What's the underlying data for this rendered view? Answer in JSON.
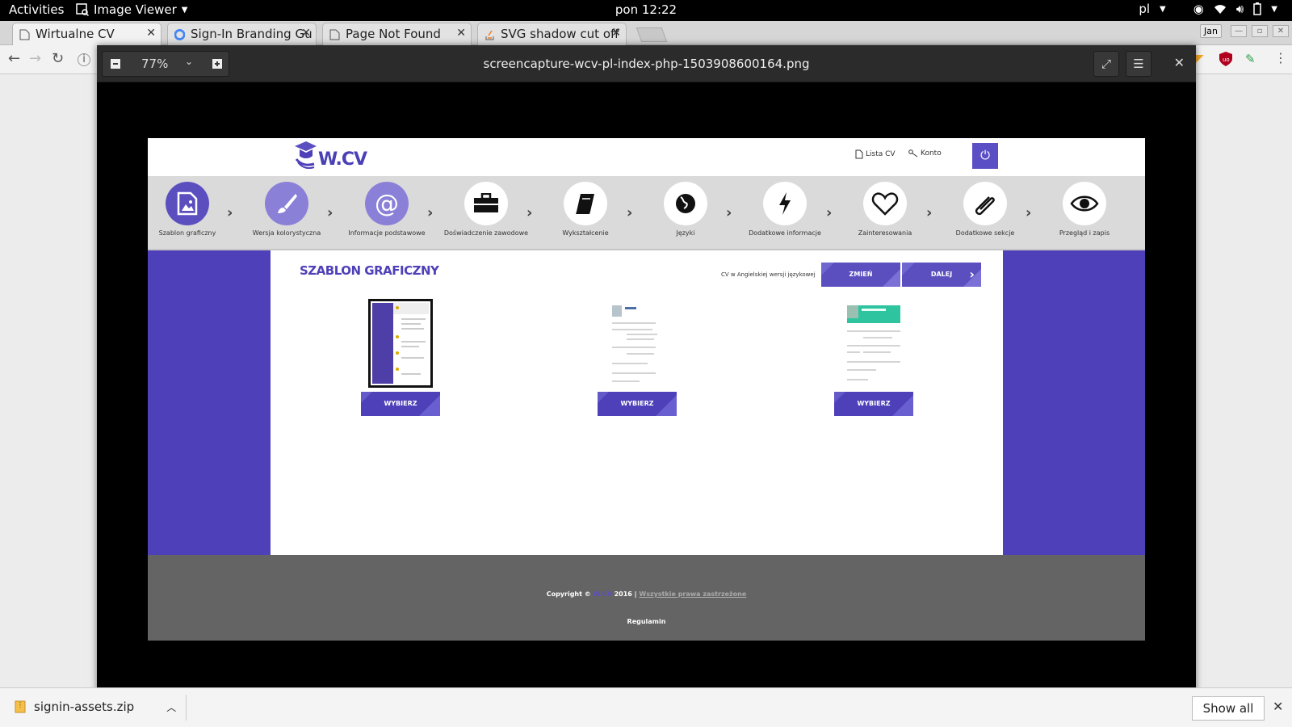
{
  "system": {
    "activities": "Activities",
    "app_menu": "Image Viewer",
    "clock": "pon 12:22",
    "lang": "pl"
  },
  "browser": {
    "tabs": [
      {
        "label": "Wirtualne CV"
      },
      {
        "label": "Sign-In Branding Gu"
      },
      {
        "label": "Page Not Found"
      },
      {
        "label": "SVG shadow cut off"
      }
    ],
    "profile": "Jan"
  },
  "viewer": {
    "zoom": "77%",
    "filename": "screencapture-wcv-pl-index-php-1503908600164.png"
  },
  "site": {
    "logo": "W.CV",
    "header_links": [
      "Lista CV",
      "Konto"
    ],
    "steps": [
      "Szablon graficzny",
      "Wersja kolorystyczna",
      "Informacje podstawowe",
      "Doświadczenie zawodowe",
      "Wykształcenie",
      "Języki",
      "Dodatkowe informacje",
      "Zainteresowania",
      "Dodatkowe sekcje",
      "Przegląd i zapis"
    ],
    "section_title": "SZABLON GRAFICZNY",
    "cv_note": "CV w Angielskiej wersji językowej",
    "change_button": "ZMIEŃ",
    "next_button": "DALEJ",
    "choose_label": "WYBIERZ",
    "footer_copyright_prefix": "Copyright ©",
    "footer_brand": "W.CV",
    "footer_year": "2016 |",
    "footer_rights": "Wszystkie prawa zastrzeżone",
    "footer_terms": "Regulamin"
  },
  "downloads": {
    "file": "signin-assets.zip",
    "show_all": "Show all"
  },
  "colors": {
    "accent": "#4e40b8",
    "accent_light": "#5b4fc0",
    "footer": "#646464"
  }
}
